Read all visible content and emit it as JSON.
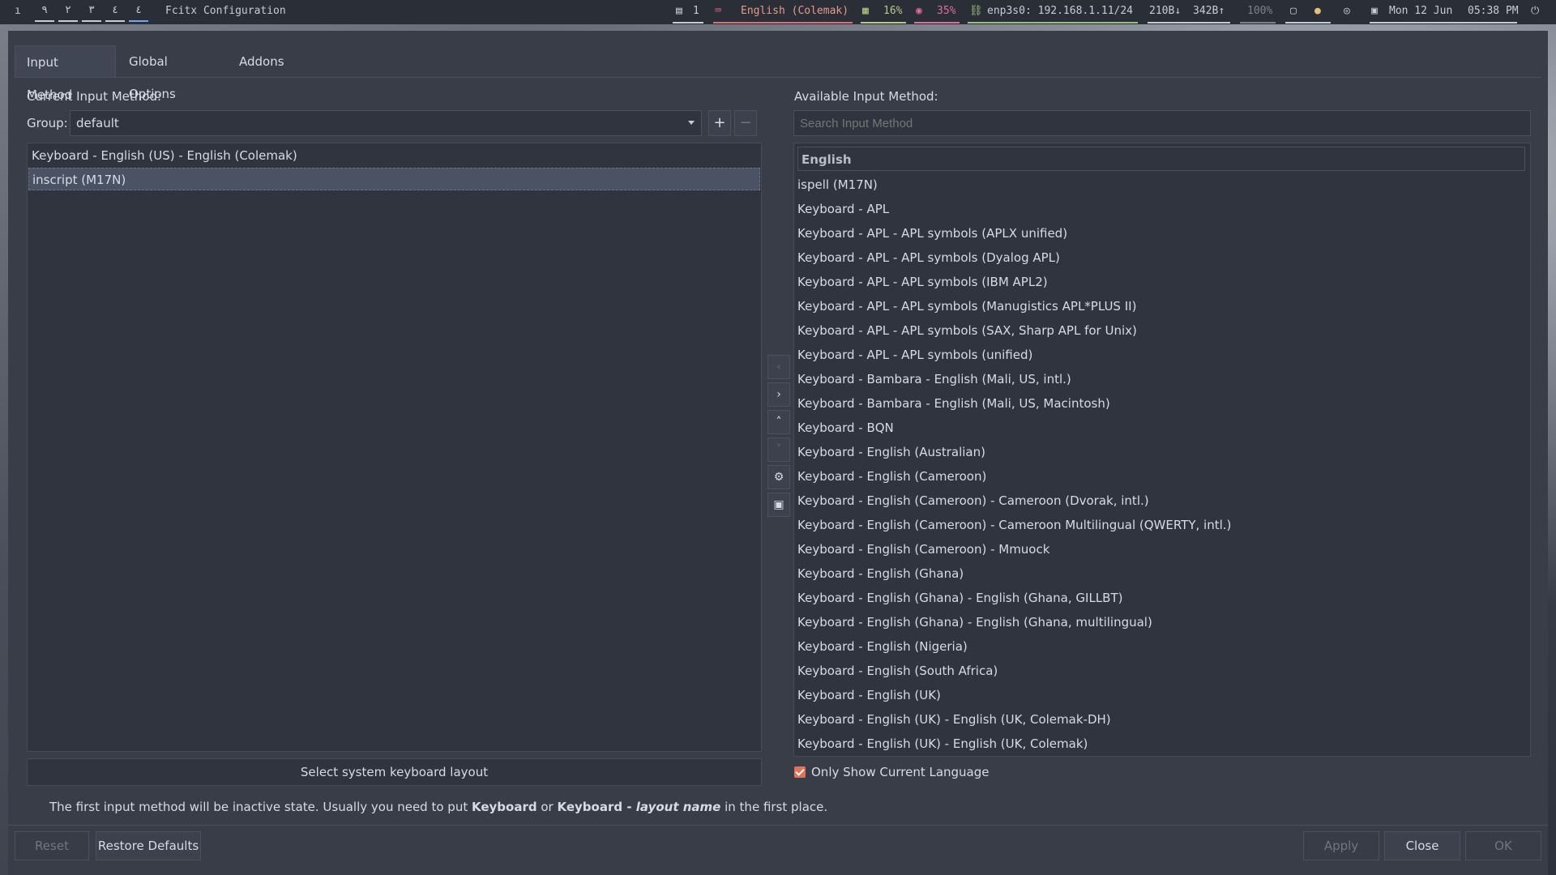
{
  "topbar": {
    "workspaces": [
      "٩",
      "٢",
      "٣",
      "٤",
      "٤"
    ],
    "window_title": "Fcitx Configuration",
    "window_count": "1",
    "keyboard_layout": "English (Colemak)",
    "memory": "16%",
    "cpu": "35%",
    "network": "enp3s0: 192.168.1.11/24",
    "down": "210B",
    "up": "342B",
    "volume": "100%",
    "date": "Mon 12 Jun",
    "time": "05:38 PM"
  },
  "tabs": [
    "Input Method",
    "Global Options",
    "Addons"
  ],
  "left": {
    "title": "Current Input Method:",
    "group_label": "Group:",
    "group_value": "default",
    "add_label": "+",
    "remove_label": "−",
    "items": [
      "Keyboard - English (US) - English (Colemak)",
      "inscript (M17N)"
    ],
    "select_layout_button": "Select system keyboard layout"
  },
  "note": {
    "part1": "The first input method will be inactive state. Usually you need to put ",
    "bold1": "Keyboard",
    "part2": " or ",
    "bold2": "Keyboard - ",
    "italic": "layout name",
    "part3": " in the first place."
  },
  "right": {
    "title": "Available Input Method:",
    "search_placeholder": "Search Input Method",
    "group_header": "English",
    "items": [
      "ispell (M17N)",
      "Keyboard - APL",
      "Keyboard - APL - APL symbols (APLX unified)",
      "Keyboard - APL - APL symbols (Dyalog APL)",
      "Keyboard - APL - APL symbols (IBM APL2)",
      "Keyboard - APL - APL symbols (Manugistics APL*PLUS II)",
      "Keyboard - APL - APL symbols (SAX, Sharp APL for Unix)",
      "Keyboard - APL - APL symbols (unified)",
      "Keyboard - Bambara - English (Mali, US, intl.)",
      "Keyboard - Bambara - English (Mali, US, Macintosh)",
      "Keyboard - BQN",
      "Keyboard - English (Australian)",
      "Keyboard - English (Cameroon)",
      "Keyboard - English (Cameroon) - Cameroon (Dvorak, intl.)",
      "Keyboard - English (Cameroon) - Cameroon Multilingual (QWERTY, intl.)",
      "Keyboard - English (Cameroon) - Mmuock",
      "Keyboard - English (Ghana)",
      "Keyboard - English (Ghana) - English (Ghana, GILLBT)",
      "Keyboard - English (Ghana) - English (Ghana, multilingual)",
      "Keyboard - English (Nigeria)",
      "Keyboard - English (South Africa)",
      "Keyboard - English (UK)",
      "Keyboard - English (UK) - English (UK, Colemak-DH)",
      "Keyboard - English (UK) - English (UK, Colemak)"
    ],
    "only_current_language": "Only Show Current Language",
    "only_current_language_checked": true
  },
  "footer": {
    "reset": "Reset",
    "restore": "Restore Defaults",
    "apply": "Apply",
    "close": "Close",
    "ok": "OK"
  }
}
